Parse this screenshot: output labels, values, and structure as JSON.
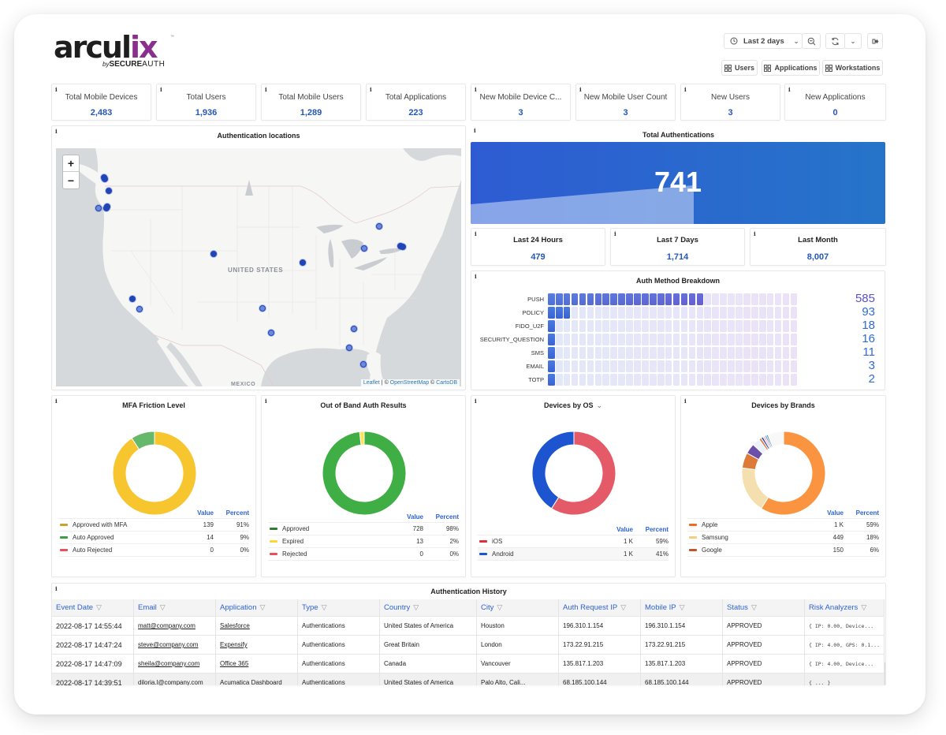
{
  "brand": {
    "name_main": "arcul",
    "name_x": "ix",
    "tm": "™",
    "by": "by",
    "secure": "SECURE",
    "auth": "AUTH"
  },
  "toolbar": {
    "time_range": "Last 2 days",
    "icons": {
      "clock": "clock-icon",
      "zoom_out": "zoom-out-icon",
      "refresh": "refresh-icon",
      "chevron": "chevron-down-icon",
      "logout": "logout-icon"
    },
    "dash_links": [
      "Users",
      "Applications",
      "Workstations"
    ]
  },
  "stats": [
    {
      "label": "Total Mobile Devices",
      "value": "2,483"
    },
    {
      "label": "Total Users",
      "value": "1,936"
    },
    {
      "label": "Total Mobile Users",
      "value": "1,289"
    },
    {
      "label": "Total Applications",
      "value": "223"
    },
    {
      "label": "New Mobile Device C...",
      "value": "3"
    },
    {
      "label": "New Mobile User Count",
      "value": "3"
    },
    {
      "label": "New Users",
      "value": "3"
    },
    {
      "label": "New Applications",
      "value": "0"
    }
  ],
  "info_glyph": "i",
  "map": {
    "title": "Authentication locations",
    "zoom_in": "+",
    "zoom_out": "−",
    "country_label": "UNITED STATES",
    "bottom_label": "MEXICO",
    "attribution": {
      "leaflet": "Leaflet",
      "sep": " | © ",
      "osm": "OpenStreetMap",
      "sep2": " © ",
      "carto": "CartoDB"
    },
    "markers": [
      {
        "name": "vancouver",
        "lon": -123.1,
        "lat": 49.3
      },
      {
        "name": "vancouver-2",
        "lon": -122.9,
        "lat": 49.1
      },
      {
        "name": "seattle",
        "lon": -122.3,
        "lat": 47.6
      },
      {
        "name": "portland",
        "lon": -122.7,
        "lat": 45.5
      },
      {
        "name": "portland-2",
        "lon": -122.5,
        "lat": 45.6
      },
      {
        "name": "oregon-coast",
        "lon": -123.9,
        "lat": 45.5
      },
      {
        "name": "denver",
        "lon": -104.9,
        "lat": 39.7
      },
      {
        "name": "st-louis",
        "lon": -90.2,
        "lat": 38.6
      },
      {
        "name": "rochester",
        "lon": -77.6,
        "lat": 43.2
      },
      {
        "name": "pittsburgh",
        "lon": -80.0,
        "lat": 40.4
      },
      {
        "name": "new-york",
        "lon": -74.0,
        "lat": 40.7
      },
      {
        "name": "new-york-2",
        "lon": -73.6,
        "lat": 40.6
      },
      {
        "name": "los-angeles",
        "lon": -118.3,
        "lat": 34.0
      },
      {
        "name": "san-diego",
        "lon": -117.2,
        "lat": 32.7
      },
      {
        "name": "dallas",
        "lon": -96.8,
        "lat": 32.8
      },
      {
        "name": "houston",
        "lon": -95.4,
        "lat": 29.8
      },
      {
        "name": "jacksonville",
        "lon": -81.7,
        "lat": 30.3
      },
      {
        "name": "tampa",
        "lon": -82.5,
        "lat": 27.9
      },
      {
        "name": "miami",
        "lon": -80.2,
        "lat": 25.8
      }
    ]
  },
  "total_auth": {
    "title": "Total Authentications",
    "value": "741",
    "periods": [
      {
        "label": "Last 24 Hours",
        "value": "479"
      },
      {
        "label": "Last 7 Days",
        "value": "1,714"
      },
      {
        "label": "Last Month",
        "value": "8,007"
      }
    ]
  },
  "auth_methods": {
    "title": "Auth Method Breakdown",
    "total_cells": 32,
    "rows": [
      {
        "label": "PUSH",
        "value": 585,
        "filled": 20,
        "color": "#5b52c9"
      },
      {
        "label": "POLICY",
        "value": 93,
        "filled": 3,
        "color": "#2d6bd6"
      },
      {
        "label": "FIDO_U2F",
        "value": 18,
        "filled": 1,
        "color": "#2d6bd6"
      },
      {
        "label": "SECURITY_QUESTION",
        "value": 16,
        "filled": 1,
        "color": "#2d6bd6"
      },
      {
        "label": "SMS",
        "value": 11,
        "filled": 1,
        "color": "#2d6bd6"
      },
      {
        "label": "EMAIL",
        "value": 3,
        "filled": 1,
        "color": "#2d6bd6"
      },
      {
        "label": "TOTP",
        "value": 2,
        "filled": 1,
        "color": "#2d6bd6"
      }
    ]
  },
  "donuts": [
    {
      "title": "MFA Friction Level",
      "has_dropdown": false,
      "value_header": "Value",
      "percent_header": "Percent",
      "slices": [
        {
          "label": "Approved with MFA",
          "value": 139,
          "display": "139",
          "percent": "91%",
          "color": "#f7c52e",
          "legend_color": "#c9a227"
        },
        {
          "label": "Auto Approved",
          "value": 14,
          "display": "14",
          "percent": "9%",
          "color": "#66b86a",
          "legend_color": "#3ea043"
        },
        {
          "label": "Auto Rejected",
          "value": 0,
          "display": "0",
          "percent": "0%",
          "color": "#e8505b",
          "legend_color": "#e8505b"
        }
      ]
    },
    {
      "title": "Out of Band Auth Results",
      "has_dropdown": false,
      "value_header": "Value",
      "percent_header": "Percent",
      "slices": [
        {
          "label": "Approved",
          "value": 728,
          "display": "728",
          "percent": "98%",
          "color": "#3fae45",
          "legend_color": "#2e7d32"
        },
        {
          "label": "Expired",
          "value": 13,
          "display": "13",
          "percent": "2%",
          "color": "#fde25a",
          "legend_color": "#fdd835"
        },
        {
          "label": "Rejected",
          "value": 0,
          "display": "0",
          "percent": "0%",
          "color": "#e8505b",
          "legend_color": "#e8505b"
        }
      ]
    },
    {
      "title": "Devices by OS",
      "has_dropdown": true,
      "dropdown_glyph": "⌄",
      "value_header": "Value",
      "percent_header": "Percent",
      "slices": [
        {
          "label": "iOS",
          "value": 59,
          "display": "1 K",
          "percent": "59%",
          "color": "#e45a68",
          "legend_color": "#e0303f"
        },
        {
          "label": "Android",
          "value": 41,
          "display": "1 K",
          "percent": "41%",
          "color": "#1d55d0",
          "legend_color": "#1d55d0"
        }
      ]
    },
    {
      "title": "Devices by Brands",
      "has_dropdown": false,
      "value_header": "Value",
      "percent_header": "Percent",
      "slices": [
        {
          "label": "Apple",
          "value": 59,
          "display": "1 K",
          "percent": "59%",
          "color": "#fb9440",
          "legend_color": "#f06d1f",
          "in_legend": true
        },
        {
          "label": "Samsung",
          "value": 18,
          "display": "449",
          "percent": "18%",
          "color": "#f6dfae",
          "legend_color": "#f5cf7f",
          "in_legend": true
        },
        {
          "label": "Google",
          "value": 6,
          "display": "150",
          "percent": "6%",
          "color": "#dc7a3a",
          "legend_color": "#c0562a",
          "in_legend": true
        },
        {
          "label": "Other-1",
          "value": 4,
          "color": "#6b4fa8",
          "in_legend": false
        },
        {
          "label": "Other-2",
          "value": 3,
          "color": "#edf3fb",
          "in_legend": false
        },
        {
          "label": "Other-3",
          "value": 1,
          "color": "#e0894e",
          "in_legend": false
        },
        {
          "label": "Other-4",
          "value": 0.8,
          "color": "#1b44b0",
          "in_legend": false
        },
        {
          "label": "Other-5",
          "value": 0.8,
          "color": "#f6b9c3",
          "in_legend": false
        },
        {
          "label": "Other-6",
          "value": 0.6,
          "color": "#3d7ad8",
          "in_legend": false
        },
        {
          "label": "Other-7",
          "value": 0.6,
          "color": "#2f7c7a",
          "in_legend": false
        },
        {
          "label": "Other-8",
          "value": 6.2,
          "color": "#f8f8f8",
          "in_legend": false
        }
      ]
    }
  ],
  "history": {
    "title": "Authentication History",
    "filter_glyph": "▽",
    "columns": [
      "Event Date",
      "Email",
      "Application",
      "Type",
      "Country",
      "City",
      "Auth Request IP",
      "Mobile IP",
      "Status",
      "Risk Analyzers"
    ],
    "rows": [
      [
        "2022-08-17 14:55:44",
        "matt@company.com",
        "Salesforce",
        "Authentications",
        "United States of America",
        "Houston",
        "196.310.1.154",
        "196.310.1.154",
        "APPROVED",
        "{ IP: 0.00, Device..."
      ],
      [
        "2022-08-17 14:47:24",
        "steve@company.com",
        "Expensify",
        "Authentications",
        "Great Britain",
        "London",
        "173.22.91.215",
        "173.22.91.215",
        "APPROVED",
        "{ IP: 4.00, GPS: 0.1..."
      ],
      [
        "2022-08-17 14:47:09",
        "sheila@company.com",
        "Office 365",
        "Authentications",
        "Canada",
        "Vancouver",
        "135.817.1.203",
        "135.817.1.203",
        "APPROVED",
        "{ IP: 4.00, Device..."
      ],
      [
        "2022-08-17 14:39:51",
        "diloria.l@company.com",
        "Acumatica Dashboard",
        "Authentications",
        "United States of America",
        "Palo Alto, Cali...",
        "68.185.100.144",
        "68.185.100.144",
        "APPROVED",
        "{ ... }"
      ]
    ]
  }
}
